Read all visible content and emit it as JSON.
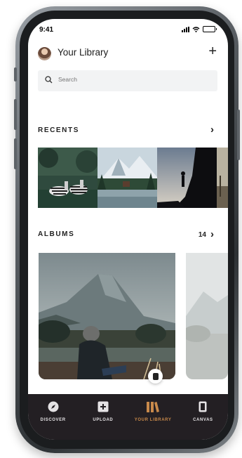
{
  "status_bar": {
    "time": "9:41"
  },
  "header": {
    "title": "Your Library",
    "add_label": "+"
  },
  "search": {
    "placeholder": "Search"
  },
  "recents": {
    "title": "RECENTS",
    "chevron": "›",
    "items": [
      {
        "name": "zebras-photo"
      },
      {
        "name": "mountain-lake-cabin-photo"
      },
      {
        "name": "silhouette-cliff-photo"
      },
      {
        "name": "sunset-field-photo"
      }
    ]
  },
  "albums": {
    "title": "ALBUMS",
    "count": "14",
    "chevron": "›",
    "items": [
      {
        "name": "misty-mountain-album"
      },
      {
        "name": "faded-mountain-album"
      }
    ]
  },
  "bottom_nav": {
    "items": [
      {
        "label": "DISCOVER",
        "icon": "compass-icon",
        "active": false
      },
      {
        "label": "UPLOAD",
        "icon": "upload-plus-icon",
        "active": false
      },
      {
        "label": "YOUR LIBRARY",
        "icon": "library-books-icon",
        "active": true
      },
      {
        "label": "CANVAS",
        "icon": "canvas-frame-icon",
        "active": false
      }
    ]
  },
  "colors": {
    "nav_bg": "#231f23",
    "accent": "#c98a4b",
    "search_bg": "#f2f3f4"
  }
}
